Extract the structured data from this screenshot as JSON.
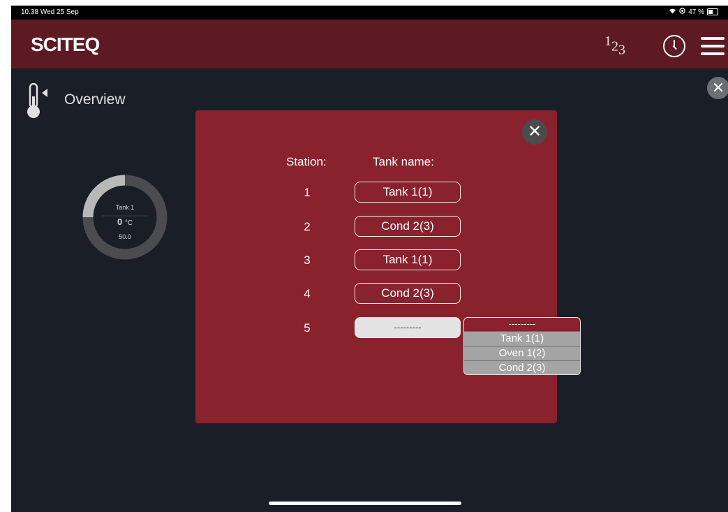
{
  "status_bar": {
    "time": "10.38",
    "date": "Wed 25 Sep",
    "battery": "47 %"
  },
  "header": {
    "logo": "SCITEQ",
    "num_base": "1",
    "num_sub": "2",
    "num_sub2": "3",
    "icons": [
      "numbers-icon",
      "clock-icon",
      "hamburger-menu-icon"
    ]
  },
  "overview": {
    "title": "Overview"
  },
  "gauge": {
    "tank": "Tank 1",
    "value": "0",
    "unit": "°C",
    "setpoint": "50.0",
    "fill_fraction": 0.25
  },
  "modal": {
    "close_glyph": "✕",
    "station_header": "Station:",
    "tank_header": "Tank name:",
    "rows": [
      {
        "station": "1",
        "tank": "Tank 1(1)"
      },
      {
        "station": "2",
        "tank": "Cond 2(3)"
      },
      {
        "station": "3",
        "tank": "Tank 1(1)"
      },
      {
        "station": "4",
        "tank": "Cond 2(3)"
      },
      {
        "station": "5",
        "tank": "---------"
      }
    ],
    "dropdown": {
      "selected": "---------",
      "options": [
        "Tank 1(1)",
        "Oven 1(2)",
        "Cond 2(3)"
      ]
    }
  },
  "background_close_glyph": "✕",
  "colors": {
    "header": "#5e1a22",
    "modal": "#8a222e",
    "background": "#1a1f27"
  }
}
